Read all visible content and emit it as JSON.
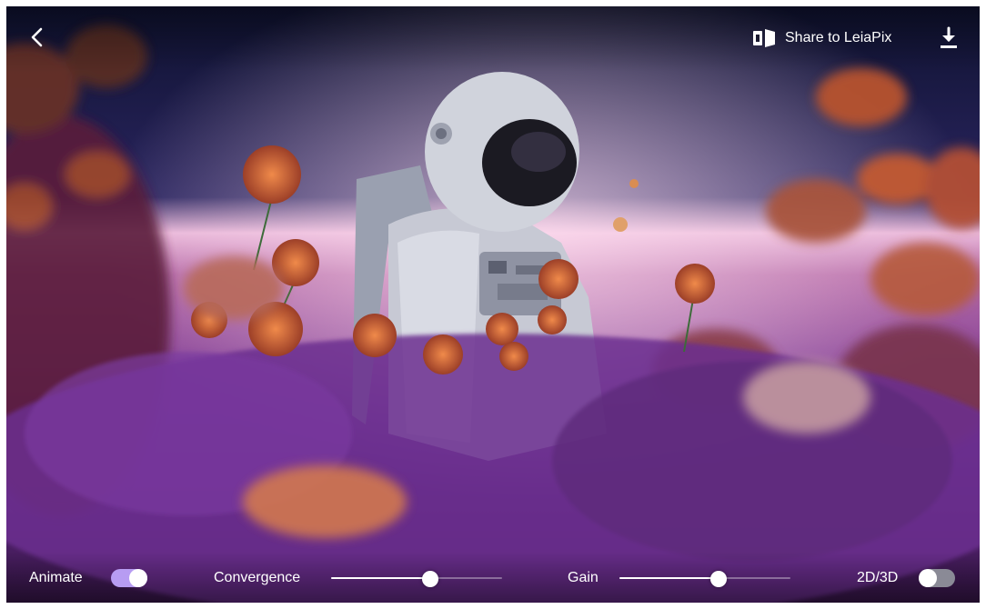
{
  "header": {
    "back_icon": "chevron-left-icon",
    "share_label": "Share to LeiaPix",
    "share_icon": "leiapix-icon",
    "download_icon": "download-icon"
  },
  "controls": {
    "animate": {
      "label": "Animate",
      "on": true,
      "accent": "#b79cf2"
    },
    "convergence": {
      "label": "Convergence",
      "value": 0.58
    },
    "gain": {
      "label": "Gain",
      "value": 0.58
    },
    "mode": {
      "label": "2D/3D",
      "on": false
    }
  },
  "colors": {
    "toggle_off": "#8a8a96",
    "sky": "#1b1f4a",
    "horizon": "#e9b7d9",
    "flower": "#d06a3c",
    "meadow": "#6b2e8f"
  }
}
